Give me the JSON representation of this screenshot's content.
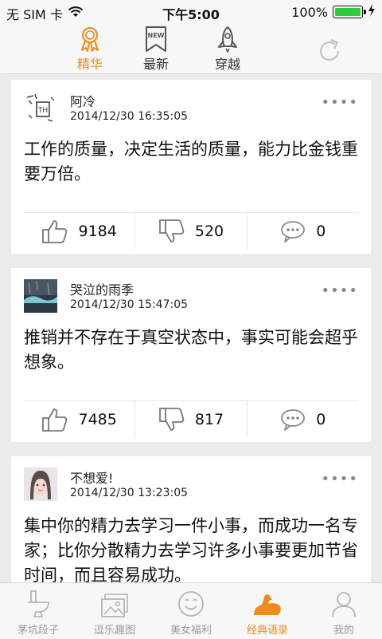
{
  "status_bar": {
    "carrier": "无 SIM 卡",
    "time": "下午5:00",
    "battery": "100%",
    "battery_level": 1.0
  },
  "top_tabs": [
    {
      "label": "精华",
      "icon": "badge-ribbon-icon",
      "active": true
    },
    {
      "label": "最新",
      "icon": "new-bookmark-icon",
      "active": false
    },
    {
      "label": "穿越",
      "icon": "rocket-icon",
      "active": false
    }
  ],
  "posts": [
    {
      "username": "阿冷",
      "time": "2014/12/30 16:35:05",
      "content": "工作的质量，决定生活的质量，能力比金钱重要万倍。",
      "likes": "9184",
      "dislikes": "520",
      "comments": "0",
      "more": "••••"
    },
    {
      "username": "哭泣的雨季",
      "time": "2014/12/30 15:47:05",
      "content": "推销并不存在于真空状态中，事实可能会超乎想象。",
      "likes": "7485",
      "dislikes": "817",
      "comments": "0",
      "more": "••••"
    },
    {
      "username": "不想爱!",
      "time": "2014/12/30 13:23:05",
      "content": "集中你的精力去学习一件小事，而成功一名专家；比你分散精力去学习许多小事要更加节省时间，而且容易成功。",
      "more": "••••"
    }
  ],
  "bottom_tabs": [
    {
      "label": "茅坑段子",
      "icon": "toilet-icon",
      "active": false
    },
    {
      "label": "逗乐趣图",
      "icon": "picture-icon",
      "active": false
    },
    {
      "label": "美女福利",
      "icon": "smiley-icon",
      "active": false
    },
    {
      "label": "经典语录",
      "icon": "muscle-arm-icon",
      "active": true
    },
    {
      "label": "我的",
      "icon": "user-icon",
      "active": false
    }
  ],
  "colors": {
    "accent": "#f08a1a",
    "inactive": "#9a9a9a",
    "background": "#ebebeb",
    "battery": "#2ecc40"
  }
}
